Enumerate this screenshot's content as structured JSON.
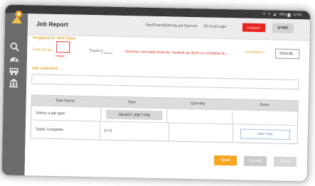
{
  "status_bar": {
    "icons": "✶ ▽ ◢",
    "battery": "96%",
    "time": "14:55"
  },
  "header": {
    "title": "Job Report",
    "user": "RedTeam@demo",
    "synced_label": "Last Synced",
    "synced_ago": "20 hours ago",
    "logout_label": "LOGOUT",
    "sync_label": "SYNC"
  },
  "sidebar": {
    "icons": [
      "logo-icon",
      "search-icon",
      "dashboard-icon",
      "truck-icon",
      "building-icon"
    ]
  },
  "form": {
    "assigned": "Assigned to: Red Team",
    "time_on_site_label": "Time on sit...",
    "required_text": "requir...",
    "travel_label": "Travel ti...",
    "warning": "At lease one task must be marked as done to complete th...",
    "scheduled_label": "Scheduled s...",
    "scheduled_value": "2019-08...",
    "comment_label": "Job comment:"
  },
  "table": {
    "headers": [
      "Task Name",
      "Type",
      "Quantity",
      "Done"
    ],
    "row1": {
      "task": "Select a job type",
      "button": "SELECT JOB TYPE"
    },
    "row2": {
      "task": "Tasks Complete",
      "count": "0 / 0",
      "button": "ADD TASK"
    }
  },
  "actions": {
    "save": "Save",
    "cancel": "Cancel",
    "done": "Done"
  },
  "colors": {
    "accent": "#f5a623",
    "logout": "#e8221f",
    "warning": "#d23a2a",
    "label": "#e0a22a"
  }
}
